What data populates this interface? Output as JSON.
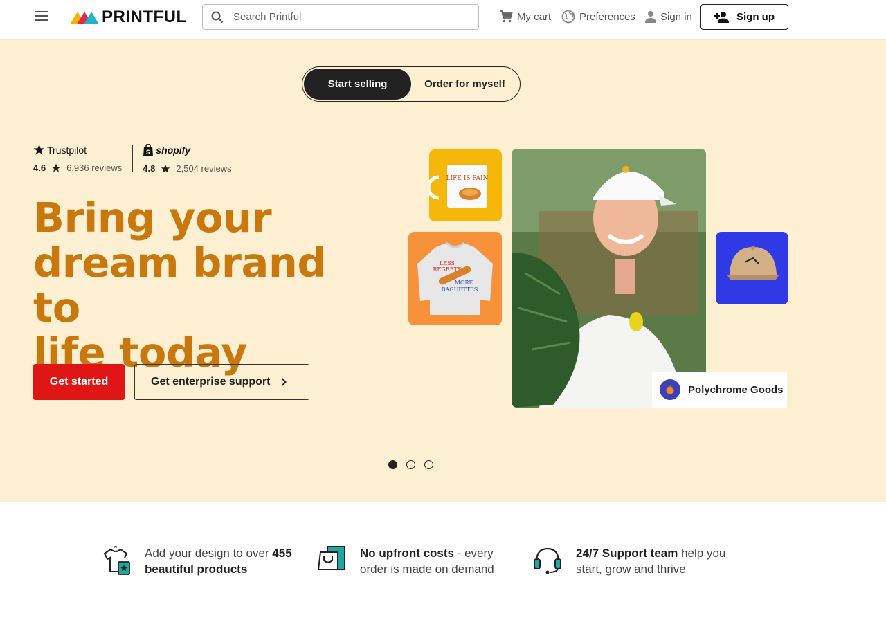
{
  "header": {
    "logo_text": "PRINTFUL",
    "search_placeholder": "Search Printful",
    "cart_label": "My cart",
    "preferences_label": "Preferences",
    "signin_label": "Sign in",
    "signup_label": "Sign up",
    "icons": [
      "menu-icon",
      "search-icon",
      "cart-icon",
      "globe-icon",
      "person-icon",
      "add-person-icon"
    ]
  },
  "hero": {
    "toggle": {
      "active": "Start selling",
      "inactive": "Order for myself"
    },
    "ratings": [
      {
        "brand": "Trustpilot",
        "score": "4.6",
        "reviews": "6,936 reviews"
      },
      {
        "brand": "shopify",
        "score": "4.8",
        "reviews": "2,504 reviews"
      }
    ],
    "headline_lines": [
      "Bring your",
      "dream brand to",
      "life today"
    ],
    "primary_cta": "Get started",
    "secondary_cta": "Get enterprise support",
    "badge_label": "Polychrome Goods",
    "carousel_pages": 3,
    "carousel_active": 1,
    "colors": {
      "background": "#fdf0d2",
      "headline": "#c9780e",
      "primary": "#e01515"
    }
  },
  "features": [
    {
      "pre": "Add your design to over ",
      "bold": "455",
      "bold2": "beautiful products",
      "post": "",
      "icon": "shirt-icon"
    },
    {
      "pre": "",
      "bold": "No upfront costs",
      "post": " - every",
      "post2": "order is made on demand",
      "icon": "shopping-bag-icon"
    },
    {
      "pre": "",
      "bold": "24/7 Support team",
      "post": " help you",
      "post2": "start, grow and thrive",
      "icon": "headset-icon"
    }
  ]
}
